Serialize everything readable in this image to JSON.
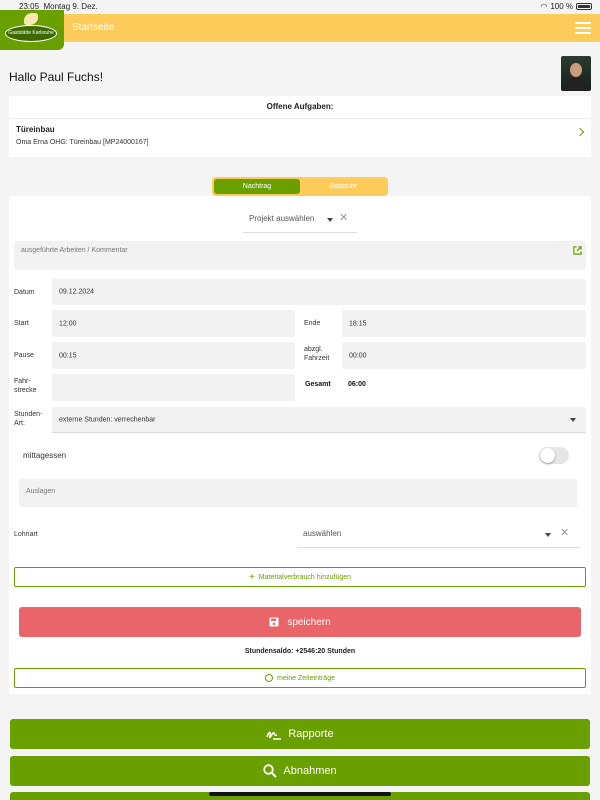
{
  "status_bar": {
    "time": "23:05",
    "date": "Montag 9. Dez.",
    "battery": "100 %"
  },
  "header": {
    "title": "Startseite",
    "logo_text": "Gaststätte Karlsruhe"
  },
  "greeting": "Hallo Paul Fuchs!",
  "open_tasks": {
    "heading": "Offene Aufgaben:",
    "items": [
      {
        "title": "Türeinbau",
        "subtitle": "Oma Erna OHG: Türeinbau [MP24000167]"
      }
    ]
  },
  "segment": {
    "active": "Nachtrag",
    "inactive": "Stoppuhr"
  },
  "form": {
    "project_placeholder": "Projekt auswählen",
    "comment_placeholder": "ausgeführte Arbeiten / Kommentar",
    "date_label": "Datum",
    "date_value": "09.12.2024",
    "start_label": "Start",
    "start_value": "12:00",
    "end_label": "Ende",
    "end_value": "18:15",
    "pause_label": "Pause",
    "pause_value": "00:15",
    "travel_label": "abzgl. Fahrzeit",
    "travel_value": "00:00",
    "distance_label": "Fahr-strecke",
    "distance_value": "",
    "total_label": "Gesamt",
    "total_value": "06:00",
    "hours_type_label": "Stunden-Art:",
    "hours_type_value": "externe Stunden: verrechenbar",
    "lunch_label": "mittagessen",
    "lunch_on": false,
    "expenses_placeholder": "Auslagen",
    "wage_type_label": "Lohnart",
    "wage_type_placeholder": "auswählen",
    "add_material_label": "Materialverbrauch hinzufügen",
    "save_label": "speichern",
    "balance_text": "Stundensaldo: +2546:20 Stunden",
    "my_entries_label": "meine Zeiteinträge"
  },
  "actions": {
    "reports_label": "Rapporte",
    "acceptances_label": "Abnahmen"
  },
  "colors": {
    "brand_green": "#6a9f00",
    "header_yellow": "#fdcb59",
    "save_red": "#e9656a"
  }
}
